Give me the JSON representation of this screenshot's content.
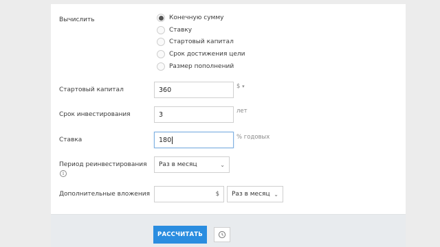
{
  "form": {
    "calculate": {
      "label": "Вычислить",
      "options": [
        {
          "label": "Конечную сумму",
          "selected": true
        },
        {
          "label": "Ставку",
          "selected": false
        },
        {
          "label": "Стартовый капитал",
          "selected": false
        },
        {
          "label": "Срок достижения цели",
          "selected": false
        },
        {
          "label": "Размер пополнений",
          "selected": false
        }
      ]
    },
    "start_capital": {
      "label": "Стартовый капитал",
      "value": "360",
      "unit": "$"
    },
    "term": {
      "label": "Срок инвестирования",
      "value": "3",
      "unit": "лет"
    },
    "rate": {
      "label": "Ставка",
      "value": "180",
      "unit": "% годовых"
    },
    "reinvest": {
      "label": "Период реинвестирования",
      "value": "Раз в месяц"
    },
    "additional": {
      "label": "Дополнительные вложения",
      "value": "",
      "currency": "$",
      "period": "Раз в месяц"
    }
  },
  "footer": {
    "calculate_button": "РАССЧИТАТЬ"
  },
  "icons": {
    "radio_selected_color": "#555555",
    "primary_color": "#2a8de0",
    "history": "clock-icon",
    "info": "info-icon"
  }
}
